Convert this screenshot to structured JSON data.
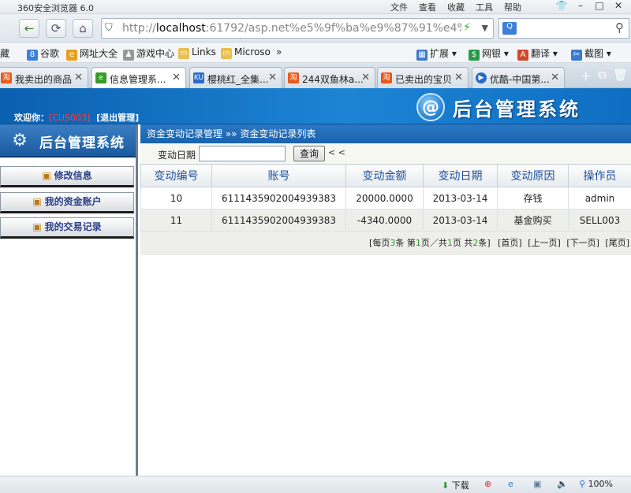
{
  "browser": {
    "title": "360安全浏览器 6.0",
    "menu": [
      "文件",
      "查看",
      "收藏",
      "工具",
      "帮助"
    ],
    "url_host": "localhost",
    "url_rest": ":61792/asp.net%e5%9f%ba%e9%87%91%e4%b",
    "favorites": [
      "藏",
      "谷歌",
      "网址大全",
      "游戏中心",
      "Links",
      "Microso",
      "»"
    ],
    "fav_right": [
      "扩展",
      "网银",
      "翻译",
      "截图"
    ],
    "tabs": [
      {
        "label": "我卖出的商品",
        "icon": "淘"
      },
      {
        "label": "信息管理系...",
        "icon": "e"
      },
      {
        "label": "樱桃红_全集...",
        "icon": "KU"
      },
      {
        "label": "244双鱼林a...",
        "icon": "淘"
      },
      {
        "label": "已卖出的宝贝",
        "icon": "淘"
      },
      {
        "label": "优酷-中国第...",
        "icon": "▶"
      }
    ],
    "status": {
      "download": "下载",
      "zoom": "100%"
    }
  },
  "header": {
    "welcome_prefix": "欢迎你：",
    "user": "[CUS003]",
    "logout": "[退出管理]",
    "brand": "后台管理系统",
    "logo_char": "@"
  },
  "sidebar": {
    "title": "后台管理系统",
    "items": [
      "修改信息",
      "我的资金账户",
      "我的交易记录"
    ]
  },
  "main": {
    "breadcrumb": "资金变动记录管理 »» 资金变动记录列表",
    "filter_label": "变动日期",
    "filter_value": "",
    "query_button": "查询",
    "arrows": "< <",
    "columns": [
      "变动编号",
      "账号",
      "变动金额",
      "变动日期",
      "变动原因",
      "操作员"
    ],
    "rows": [
      [
        "10",
        "6111435902004939383",
        "20000.0000",
        "2013-03-14",
        "存钱",
        "admin"
      ],
      [
        "11",
        "6111435902004939383",
        "-4340.0000",
        "2013-03-14",
        "基金购买",
        "SELL003"
      ]
    ],
    "pager": {
      "p1": "[每页",
      "per_page": "3",
      "p2": "条 第",
      "page": "1",
      "p3": "页／共",
      "pages": "1",
      "p4": "页 共",
      "total": "2",
      "p5": "条]",
      "first": "[首页]",
      "prev": "[上一页]",
      "next": "[下一页]",
      "last": "[尾页]"
    }
  },
  "colors": {
    "header_blue": "#1a72c4",
    "user_red": "#ff3b3b",
    "column_blue": "#1d4f9c",
    "pager_green": "#2a9a2a"
  }
}
